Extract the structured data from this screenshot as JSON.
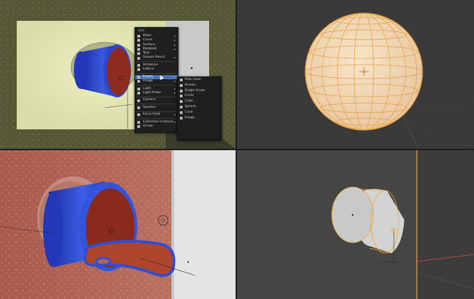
{
  "add_menu": {
    "title": "Add",
    "items": [
      {
        "label": "Mesh",
        "icon": "mesh-icon",
        "submenu": true
      },
      {
        "label": "Curve",
        "icon": "curve-icon",
        "submenu": true
      },
      {
        "label": "Surface",
        "icon": "surface-icon",
        "submenu": true
      },
      {
        "label": "Metaball",
        "icon": "metaball-icon",
        "submenu": true
      },
      {
        "label": "Text",
        "icon": "text-icon",
        "submenu": false
      },
      {
        "label": "Grease Pencil",
        "icon": "grease-pencil-icon",
        "submenu": true
      },
      {
        "label": "Armature",
        "icon": "armature-icon",
        "submenu": false
      },
      {
        "label": "Lattice",
        "icon": "lattice-icon",
        "submenu": false
      },
      {
        "label": "Empty",
        "icon": "empty-icon",
        "submenu": true
      },
      {
        "label": "Image",
        "icon": "image-icon",
        "submenu": true
      },
      {
        "label": "Light",
        "icon": "light-icon",
        "submenu": true
      },
      {
        "label": "Light Probe",
        "icon": "light-probe-icon",
        "submenu": true
      },
      {
        "label": "Camera",
        "icon": "camera-icon",
        "submenu": false
      },
      {
        "label": "Speaker",
        "icon": "speaker-icon",
        "submenu": false
      },
      {
        "label": "Force Field",
        "icon": "force-field-icon",
        "submenu": true
      },
      {
        "label": "Collection Instance",
        "icon": "collection-icon",
        "submenu": true
      },
      {
        "label": "Ocean",
        "icon": "ocean-icon",
        "submenu": false
      }
    ],
    "active_item": "Empty"
  },
  "empty_submenu": {
    "items": [
      {
        "label": "Plain Axes",
        "icon": "plain-axes-icon"
      },
      {
        "label": "Arrows",
        "icon": "arrows-icon"
      },
      {
        "label": "Single Arrow",
        "icon": "single-arrow-icon"
      },
      {
        "label": "Circle",
        "icon": "circle-icon"
      },
      {
        "label": "Cube",
        "icon": "cube-icon"
      },
      {
        "label": "Sphere",
        "icon": "sphere-icon"
      },
      {
        "label": "Cone",
        "icon": "cone-icon"
      },
      {
        "label": "Image",
        "icon": "image-icon"
      }
    ]
  },
  "colors": {
    "menu_bg": "#1f1f1f",
    "menu_highlight": "#4772b3",
    "cylinder_blue": "#2f4fd0",
    "cylinder_interior": "#8e2a1e",
    "sphere_fill": "#f1d9b8",
    "sphere_wire": "#e8a23a",
    "selection_orange": "#f5a623",
    "wall_pink": "#b46455",
    "wall_olive": "#575a38"
  }
}
